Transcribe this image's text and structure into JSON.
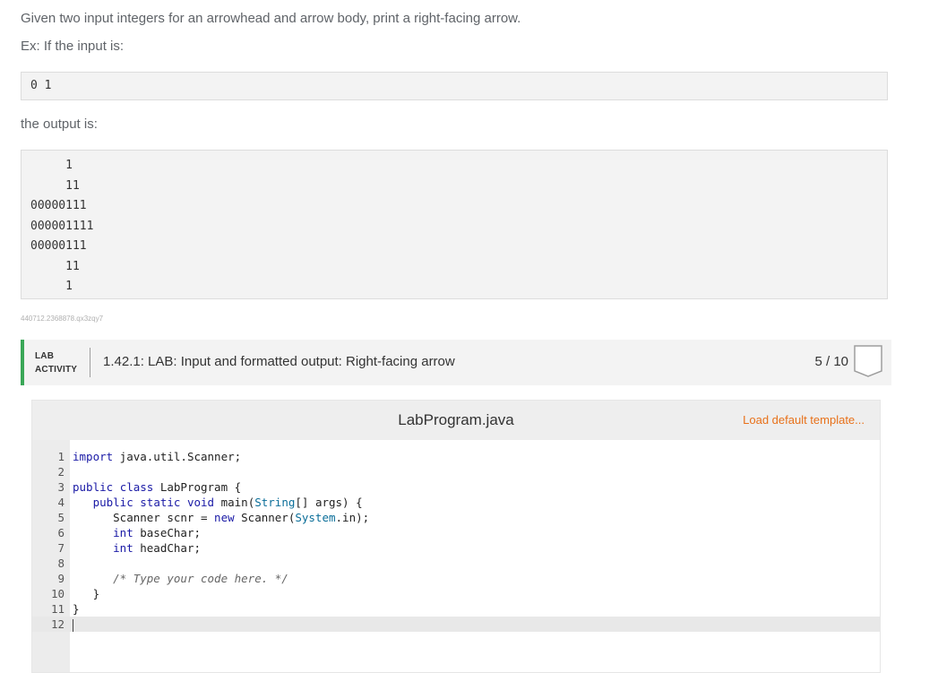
{
  "prompt": {
    "description": "Given two input integers for an arrowhead and arrow body, print a right-facing arrow.",
    "example_label": "Ex: If the input is:",
    "input": "0 1",
    "output_label": "the output is:",
    "output": "     1\n     11\n00000111\n000001111\n00000111\n     11\n     1",
    "reference_id": "440712.2368878.qx3zqy7"
  },
  "lab": {
    "tag_line1": "LAB",
    "tag_line2": "ACTIVITY",
    "title": "1.42.1: LAB: Input and formatted output: Right-facing arrow",
    "score": "5 / 10",
    "accent_color": "#3aa757"
  },
  "editor": {
    "filename": "LabProgram.java",
    "load_template_label": "Load default template...",
    "link_color": "#e8711a",
    "line_numbers": [
      "1",
      "2",
      "3",
      "4",
      "5",
      "6",
      "7",
      "8",
      "9",
      "10",
      "11",
      "12"
    ],
    "lines": [
      "import java.util.Scanner;",
      "",
      "public class LabProgram {",
      "   public static void main(String[] args) {",
      "      Scanner scnr = new Scanner(System.in);",
      "      int baseChar;",
      "      int headChar;",
      "",
      "      /* Type your code here. */",
      "   }",
      "}",
      ""
    ]
  }
}
